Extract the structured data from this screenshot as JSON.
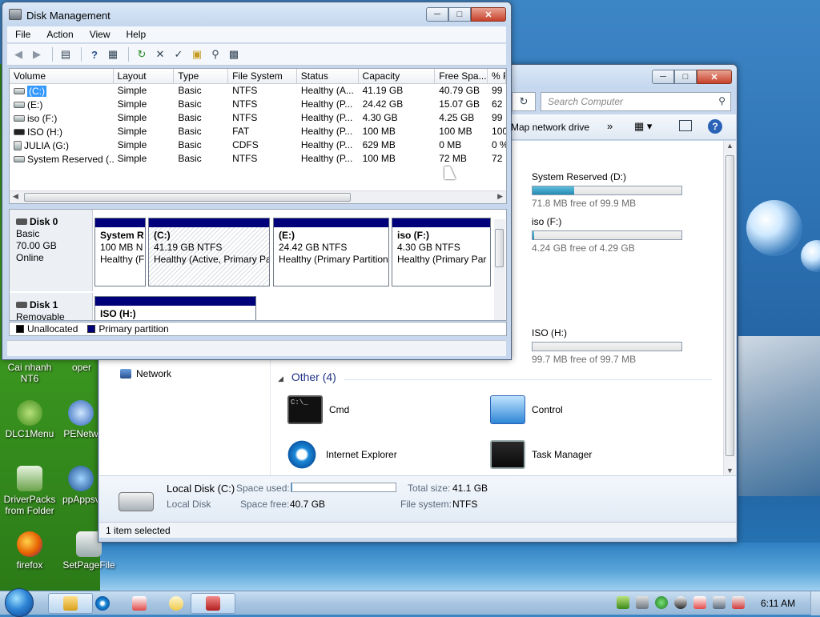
{
  "colors": {
    "partition_bar": "#00007a",
    "unallocated": "#000000",
    "selection": "#3399ff",
    "drive_fill": "#2389b5",
    "other_heading": "#1e3287"
  },
  "desktop": {
    "icons": [
      {
        "label": "Cai nhanh NT6",
        "icon": "app-icon"
      },
      {
        "label": "oper",
        "icon": "app-icon"
      },
      {
        "label": "DLC1Menu",
        "icon": "menu-icon"
      },
      {
        "label": "PENetw",
        "icon": "network-icon"
      },
      {
        "label": "DriverPacks from Folder",
        "icon": "driver-icon"
      },
      {
        "label": "ppAppsv",
        "icon": "app-icon"
      },
      {
        "label": "firefox",
        "icon": "firefox-icon"
      },
      {
        "label": "SetPageFile",
        "icon": "pagefile-icon"
      }
    ]
  },
  "disk_mgmt": {
    "title": "Disk Management",
    "menu": [
      "File",
      "Action",
      "View",
      "Help"
    ],
    "columns": [
      "Volume",
      "Layout",
      "Type",
      "File System",
      "Status",
      "Capacity",
      "Free Spa...",
      "% F"
    ],
    "rows": [
      {
        "volume": "(C:)",
        "layout": "Simple",
        "type": "Basic",
        "fs": "NTFS",
        "status": "Healthy (A...",
        "capacity": "41.19 GB",
        "free": "40.79 GB",
        "pct": "99",
        "selected": true
      },
      {
        "volume": "(E:)",
        "layout": "Simple",
        "type": "Basic",
        "fs": "NTFS",
        "status": "Healthy (P...",
        "capacity": "24.42 GB",
        "free": "15.07 GB",
        "pct": "62",
        "selected": false
      },
      {
        "volume": "iso (F:)",
        "layout": "Simple",
        "type": "Basic",
        "fs": "NTFS",
        "status": "Healthy (P...",
        "capacity": "4.30 GB",
        "free": "4.25 GB",
        "pct": "99",
        "selected": false
      },
      {
        "volume": "ISO (H:)",
        "layout": "Simple",
        "type": "Basic",
        "fs": "FAT",
        "status": "Healthy (P...",
        "capacity": "100 MB",
        "free": "100 MB",
        "pct": "100",
        "selected": false
      },
      {
        "volume": "JULIA (G:)",
        "layout": "Simple",
        "type": "Basic",
        "fs": "CDFS",
        "status": "Healthy (P...",
        "capacity": "629 MB",
        "free": "0 MB",
        "pct": "0 %",
        "selected": false
      },
      {
        "volume": "System Reserved (...",
        "layout": "Simple",
        "type": "Basic",
        "fs": "NTFS",
        "status": "Healthy (P...",
        "capacity": "100 MB",
        "free": "72 MB",
        "pct": "72",
        "selected": false
      }
    ],
    "disk0": {
      "name": "Disk 0",
      "type": "Basic",
      "size": "70.00 GB",
      "state": "Online"
    },
    "disk0_parts": [
      {
        "title": "System R",
        "size": "100 MB N",
        "status": "Healthy (F"
      },
      {
        "title": "(C:)",
        "size": "41.19 GB NTFS",
        "status": "Healthy (Active, Primary Pa"
      },
      {
        "title": "(E:)",
        "size": "24.42 GB NTFS",
        "status": "Healthy (Primary Partition"
      },
      {
        "title": "iso  (F:)",
        "size": "4.30 GB NTFS",
        "status": "Healthy (Primary Par"
      }
    ],
    "disk1": {
      "name": "Disk 1",
      "type": "Removable"
    },
    "disk1_part": {
      "title": "ISO  (H:)"
    },
    "legend": [
      "Unallocated",
      "Primary partition"
    ]
  },
  "explorer": {
    "search_placeholder": "Search Computer",
    "map_network_drive": "Map network drive",
    "drives": [
      {
        "name": "System Reserved (D:)",
        "free_text": "71.8 MB free of 99.9 MB",
        "used_fraction": 0.28
      },
      {
        "name": "iso (F:)",
        "free_text": "4.24 GB free of 4.29 GB",
        "used_fraction": 0.01
      },
      {
        "name": "ISO (H:)",
        "free_text": "99.7 MB free of 99.7 MB",
        "used_fraction": 0.0
      }
    ],
    "nav_network": "Network",
    "other_heading": "Other (4)",
    "other_items": [
      {
        "label": "Cmd",
        "icon": "cmd-icon"
      },
      {
        "label": "Control",
        "icon": "control-panel-icon"
      },
      {
        "label": "Internet Explorer",
        "icon": "internet-explorer-icon"
      },
      {
        "label": "Task Manager",
        "icon": "task-manager-icon"
      }
    ],
    "details": {
      "name": "Local Disk (C:)",
      "kind": "Local Disk",
      "space_used_label": "Space used:",
      "space_used_fraction": 0.01,
      "space_free_label": "Space free:",
      "space_free": "40.7 GB",
      "total_size_label": "Total size:",
      "total_size": "41.1 GB",
      "file_system_label": "File system:",
      "file_system": "NTFS"
    },
    "status": "1 item selected"
  },
  "taskbar": {
    "clock": "6:11 AM"
  }
}
